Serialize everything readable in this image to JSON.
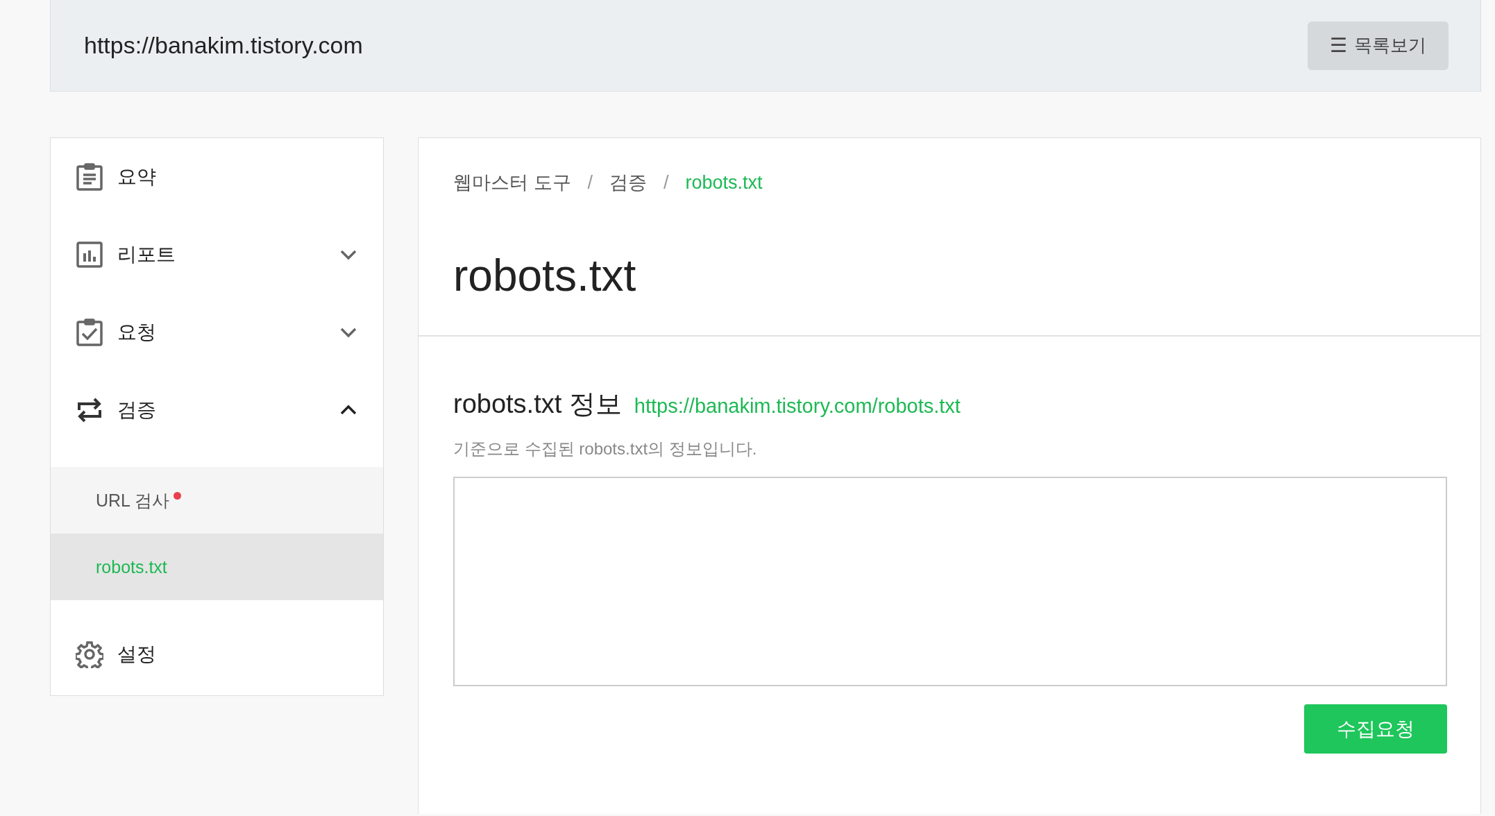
{
  "header": {
    "url": "https://banakim.tistory.com",
    "list_button": {
      "icon": "☰",
      "label": "목록보기"
    }
  },
  "sidebar": {
    "items": [
      {
        "label": "요약"
      },
      {
        "label": "리포트",
        "expanded": false
      },
      {
        "label": "요청",
        "expanded": false
      },
      {
        "label": "검증",
        "expanded": true,
        "children": [
          {
            "label": "URL 검사",
            "selected": false,
            "alert": true
          },
          {
            "label": "robots.txt",
            "selected": true,
            "alert": false
          }
        ]
      },
      {
        "label": "설정"
      }
    ]
  },
  "breadcrumb_separators": [
    "/",
    "/"
  ],
  "breadcrumb": [
    {
      "label": "웹마스터 도구",
      "current": false
    },
    {
      "label": "검증",
      "current": false
    },
    {
      "label": "robots.txt",
      "current": true
    }
  ],
  "page_title": "robots.txt",
  "section": {
    "title": "robots.txt 정보",
    "link": "https://banakim.tistory.com/robots.txt",
    "note": "기준으로 수집된 robots.txt의 정보입니다."
  },
  "request_button": "수집요청"
}
